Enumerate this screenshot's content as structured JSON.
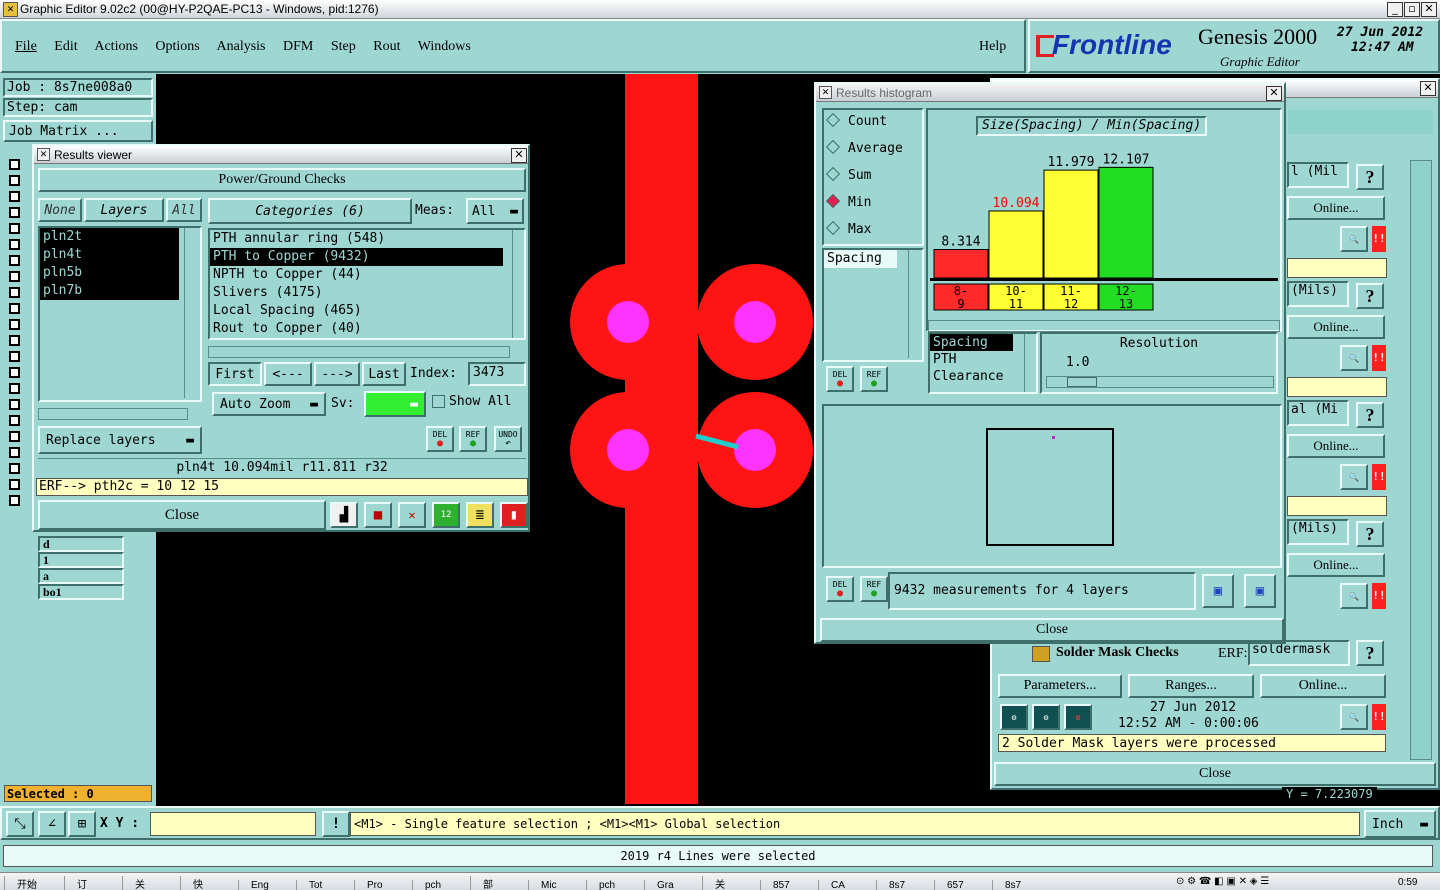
{
  "window": {
    "title": "Graphic Editor 9.02c2 (00@HY-P2QAE-PC13 - Windows, pid:1276)"
  },
  "menu": [
    "File",
    "Edit",
    "Actions",
    "Options",
    "Analysis",
    "DFM",
    "Step",
    "Rout",
    "Windows"
  ],
  "help": "Help",
  "brand": {
    "logo": "Frontline",
    "product": "Genesis 2000",
    "subtitle": "Graphic Editor",
    "date": "27 Jun 2012",
    "time": "12:47 AM"
  },
  "left": {
    "job": "Job : 8s7ne008a0",
    "step": "Step: cam",
    "job_matrix": "Job Matrix ...",
    "layers": [
      "d",
      "1",
      "a",
      "bo1"
    ],
    "selected": "Selected : 0"
  },
  "results_viewer": {
    "title": "Results viewer",
    "header": "Power/Ground Checks",
    "none_btn": "None",
    "layers_btn": "Layers",
    "all_btn": "All",
    "categories_btn": "Categories (6)",
    "meas_label": "Meas:",
    "meas_value": "All",
    "layers": [
      "pln2t",
      "pln4t",
      "pln5b",
      "pln7b"
    ],
    "categories": [
      "PTH annular ring (548)",
      "PTH to Copper (9432)",
      "NPTH to Copper (44)",
      "Slivers (4175)",
      "Local Spacing (465)",
      "Rout to Copper (40)"
    ],
    "first": "First",
    "prev": "<---",
    "next": "--->",
    "last": "Last",
    "index_label": "Index:",
    "index_value": "3473",
    "auto_zoom": "Auto Zoom",
    "sv_label": "Sv:",
    "show_all": "Show All",
    "replace_layers": "Replace layers",
    "del": "DEL",
    "ref": "REF",
    "undo": "UNDO",
    "status": "pln4t 10.094mil r11.811 r32",
    "erf": "ERF--> pth2c = 10 12 15",
    "close": "Close"
  },
  "histogram": {
    "title": "Results histogram",
    "modes": [
      "Count",
      "Average",
      "Sum",
      "Min",
      "Max"
    ],
    "selected_mode": "Min",
    "spacing_list": [
      "Spacing"
    ],
    "resolution_list": [
      "Spacing",
      "PTH",
      "Clearance"
    ],
    "resolution_label": "Resolution",
    "resolution_value": "1.0",
    "summary": "9432 measurements for 4 layers",
    "close": "Close",
    "del": "DEL",
    "ref": "REF"
  },
  "chart_data": {
    "type": "bar",
    "title": "Size(Spacing) / Min(Spacing)",
    "categories": [
      "8-9",
      "10-11",
      "11-12",
      "12-13"
    ],
    "values": [
      8.314,
      10.094,
      11.979,
      12.107
    ],
    "value_labels": [
      "8.314",
      "10.094",
      "11.979",
      "12.107"
    ],
    "colors": [
      "#ff2a2a",
      "#ffff33",
      "#ffff33",
      "#22dd22"
    ],
    "label_colors": [
      "#000000",
      "#ff0000",
      "#000000",
      "#000000"
    ],
    "ylim": [
      0,
      13
    ],
    "xlabel": "",
    "ylabel": "",
    "grid": false
  },
  "dfm_panel": {
    "rows": [
      {
        "label": "l (Mil",
        "online": "Online..."
      },
      {
        "label": "(Mils)",
        "online": "Online..."
      },
      {
        "label": "al (Mi",
        "online": "Online..."
      },
      {
        "label": "(Mils)",
        "online": "Online..."
      }
    ],
    "solder_mask": "Solder Mask Checks",
    "erf_label": "ERF:",
    "erf_value": "soldermask",
    "parameters": "Parameters...",
    "ranges": "Ranges...",
    "online": "Online...",
    "date": "27 Jun 2012",
    "time_range": "12:52 AM - 0:00:06",
    "message": "2 Solder Mask layers were processed",
    "close": "Close",
    "question": "?",
    "alarm": "!!",
    "coord_y": "Y = 7.223079"
  },
  "bottom": {
    "xy_label": "X Y :",
    "hint": "<M1> - Single feature selection ; <M1><M1> Global selection",
    "units": "Inch",
    "status": "2019 r4 Lines were selected"
  },
  "taskbar": [
    "开始",
    "订",
    "关",
    "快",
    "Eng",
    "Tot",
    "Pro",
    "pch",
    "部",
    "Mic",
    "pch",
    "Gra",
    "关",
    "857",
    "CA",
    "8s7",
    "657",
    "8s7"
  ],
  "clock": "0:59"
}
